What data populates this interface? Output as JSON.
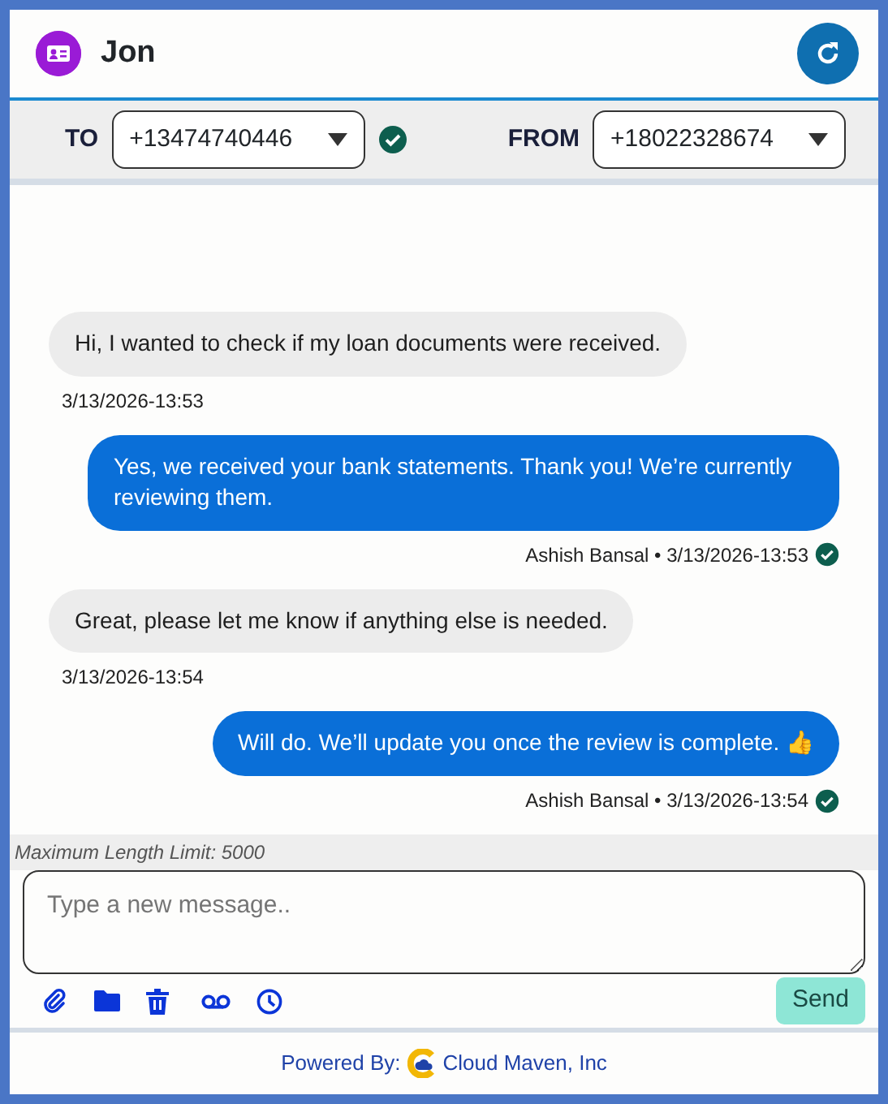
{
  "header": {
    "title": "Jon"
  },
  "recipients": [
    {
      "label": "TO",
      "value": "+13474740446",
      "verified": true
    },
    {
      "label": "FROM",
      "value": "+18022328674",
      "verified": false
    }
  ],
  "messages": [
    {
      "kind": "incoming",
      "text": "Hi, I wanted to check if my loan documents were received.",
      "meta": "3/13/2026-13:53",
      "delivered": false
    },
    {
      "kind": "outgoing",
      "text": "Yes, we received your bank statements. Thank you! We’re currently reviewing them.",
      "meta": "Ashish Bansal • 3/13/2026-13:53",
      "delivered": true
    },
    {
      "kind": "incoming",
      "text": "Great, please let me know if anything else is needed.",
      "meta": "3/13/2026-13:54",
      "delivered": false
    },
    {
      "kind": "outgoing",
      "text": "Will do. We’ll update you once the review is complete. 👍",
      "meta": "Ashish Bansal • 3/13/2026-13:54",
      "delivered": true
    }
  ],
  "composer": {
    "limit_note": "Maximum Length Limit: 5000",
    "placeholder": "Type a new message..",
    "send": "Send"
  },
  "footer": {
    "label": "Powered By:",
    "company": "Cloud Maven, Inc"
  }
}
